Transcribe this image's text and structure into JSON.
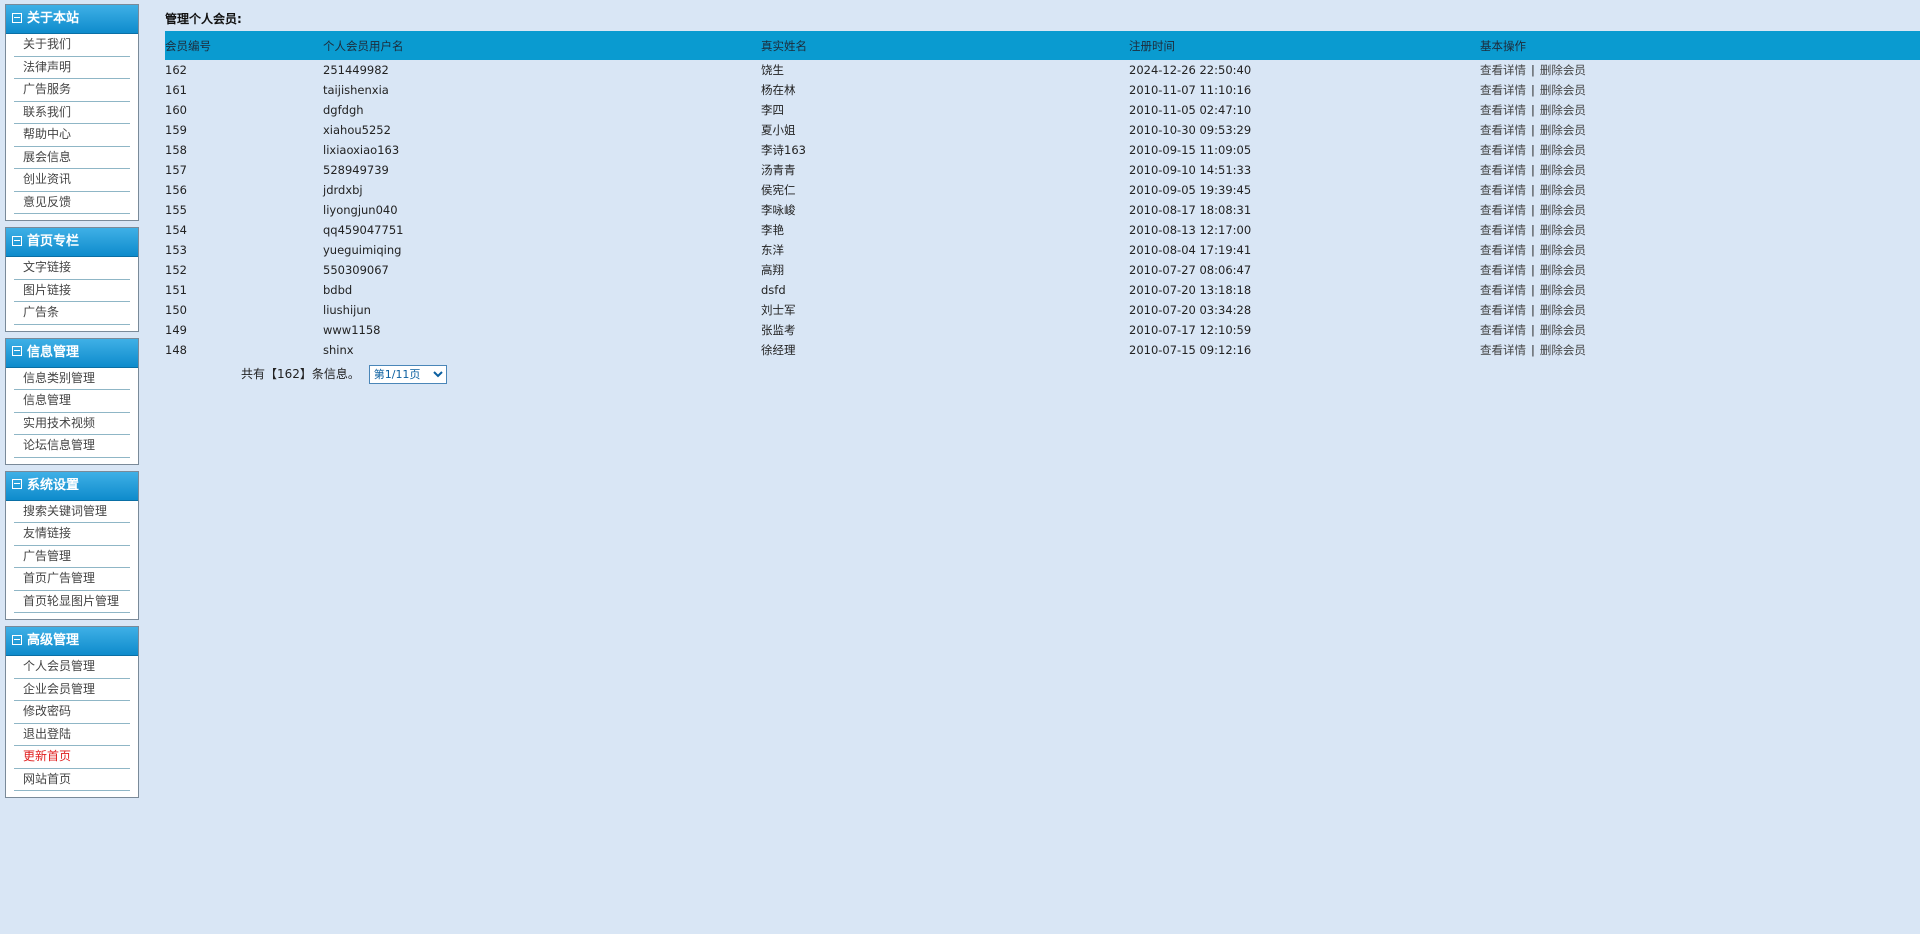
{
  "sidebar": {
    "panels": [
      {
        "title": "关于本站",
        "items": [
          "关于我们",
          "法律声明",
          "广告服务",
          "联系我们",
          "帮助中心",
          "展会信息",
          "创业资讯",
          "意见反馈"
        ]
      },
      {
        "title": "首页专栏",
        "items": [
          "文字链接",
          "图片链接",
          "广告条"
        ]
      },
      {
        "title": "信息管理",
        "items": [
          "信息类别管理",
          "信息管理",
          "实用技术视频",
          "论坛信息管理"
        ]
      },
      {
        "title": "系统设置",
        "items": [
          "搜索关键词管理",
          "友情链接",
          "广告管理",
          "首页广告管理",
          "首页轮显图片管理"
        ]
      },
      {
        "title": "高级管理",
        "items": [
          "个人会员管理",
          "企业会员管理",
          "修改密码",
          "退出登陆",
          "更新首页",
          "网站首页"
        ]
      }
    ],
    "highlight_color": "#e02020"
  },
  "main": {
    "title": "管理个人会员:",
    "header_color": "#0a9bd0",
    "columns": [
      "会员编号",
      "个人会员用户名",
      "真实姓名",
      "注册时间",
      "基本操作"
    ],
    "ops": {
      "detail": "查看详情",
      "sep": "|",
      "delete": "删除会员"
    },
    "rows": [
      [
        "162",
        "251449982",
        "饶生",
        "2024-12-26 22:50:40"
      ],
      [
        "161",
        "taijishenxia",
        "杨在林",
        "2010-11-07 11:10:16"
      ],
      [
        "160",
        "dgfdgh",
        "李四",
        "2010-11-05 02:47:10"
      ],
      [
        "159",
        "xiahou5252",
        "夏小姐",
        "2010-10-30 09:53:29"
      ],
      [
        "158",
        "lixiaoxiao163",
        "李诗163",
        "2010-09-15 11:09:05"
      ],
      [
        "157",
        "528949739",
        "汤青青",
        "2010-09-10 14:51:33"
      ],
      [
        "156",
        "jdrdxbj",
        "侯宪仁",
        "2010-09-05 19:39:45"
      ],
      [
        "155",
        "liyongjun040",
        "李咏峻",
        "2010-08-17 18:08:31"
      ],
      [
        "154",
        "qq459047751",
        "李艳",
        "2010-08-13 12:17:00"
      ],
      [
        "153",
        "yueguimiqing",
        "东洋",
        "2010-08-04 17:19:41"
      ],
      [
        "152",
        "550309067",
        "高翔",
        "2010-07-27 08:06:47"
      ],
      [
        "151",
        "bdbd",
        "dsfd",
        "2010-07-20 13:18:18"
      ],
      [
        "150",
        "liushijun",
        "刘士军",
        "2010-07-20 03:34:28"
      ],
      [
        "149",
        "www1158",
        "张监考",
        "2010-07-17 12:10:59"
      ],
      [
        "148",
        "shinx",
        "徐经理",
        "2010-07-15 09:12:16"
      ]
    ],
    "pager": {
      "text": "共有【162】条信息。",
      "select_value": "第1/11页"
    }
  }
}
